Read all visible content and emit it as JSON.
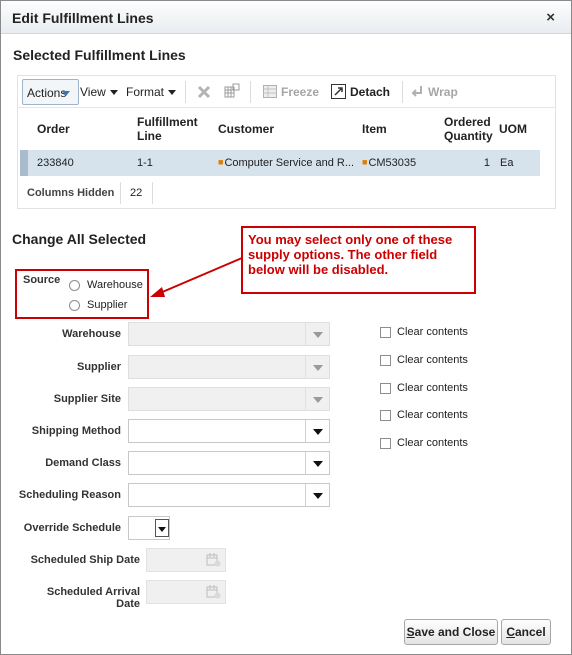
{
  "dialog": {
    "title": "Edit Fulfillment Lines",
    "close_icon": "×"
  },
  "selected_section": {
    "title": "Selected Fulfillment Lines"
  },
  "toolbar": {
    "actions": "Actions",
    "view": "View",
    "format": "Format",
    "freeze": "Freeze",
    "detach": "Detach",
    "wrap": "Wrap"
  },
  "table": {
    "headers": {
      "order": "Order",
      "line_1": "Fulfillment",
      "line_2": "Line",
      "customer": "Customer",
      "item": "Item",
      "qty_1": "Ordered",
      "qty_2": "Quantity",
      "uom": "UOM"
    },
    "rows": [
      {
        "order": "233840",
        "line": "1-1",
        "customer": "Computer Service and R...",
        "item": "CM53035",
        "qty": "1",
        "uom": "Ea"
      }
    ],
    "columns_hidden_label": "Columns Hidden",
    "columns_hidden_value": "22"
  },
  "change_section": {
    "title": "Change All Selected"
  },
  "callout": {
    "text": "You may select only one of these supply options. The other field below will be disabled."
  },
  "source": {
    "label": "Source",
    "options": [
      "Warehouse",
      "Supplier"
    ]
  },
  "fields": {
    "warehouse": "Warehouse",
    "supplier": "Supplier",
    "supplier_site": "Supplier Site",
    "shipping_method": "Shipping Method",
    "demand_class": "Demand Class",
    "scheduling_reason": "Scheduling Reason",
    "override_schedule": "Override Schedule",
    "scheduled_ship_date": "Scheduled Ship Date",
    "scheduled_arrival_date": "Scheduled Arrival Date"
  },
  "clear_contents": [
    "Clear contents",
    "Clear contents",
    "Clear contents",
    "Clear contents",
    "Clear contents"
  ],
  "buttons": {
    "save_close_mnemonic": "S",
    "save_close_rest": "ave and Close",
    "cancel_mnemonic": "C",
    "cancel_rest": "ancel"
  },
  "colors": {
    "callout": "#cc0000",
    "accent": "#3b73b9",
    "selected_row": "#d6e2ec"
  }
}
